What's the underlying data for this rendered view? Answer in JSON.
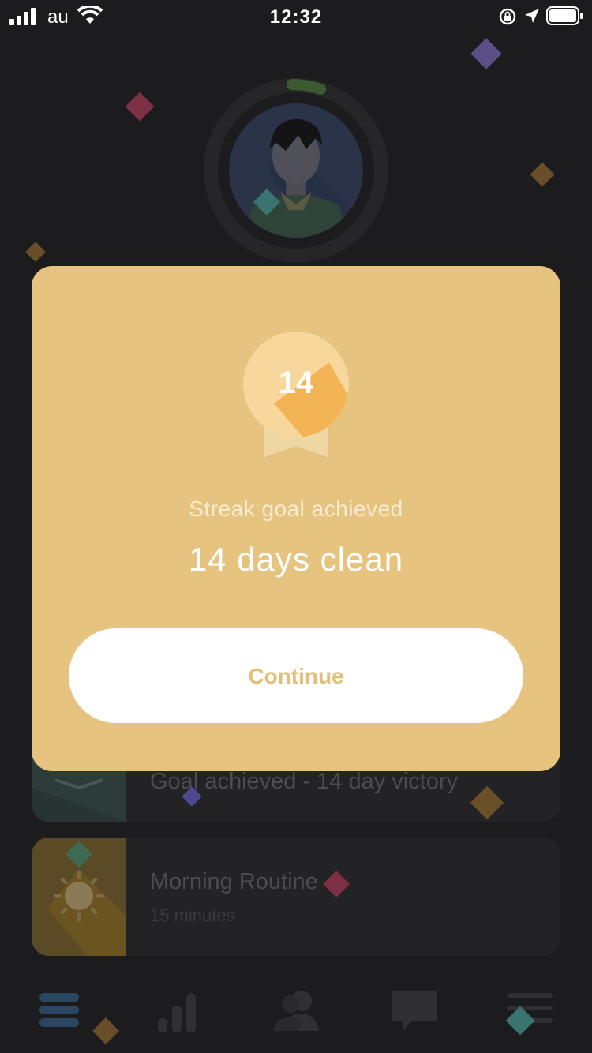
{
  "status_bar": {
    "carrier": "au",
    "time": "12:32"
  },
  "background": {
    "cards": [
      {
        "title": "Goal achieved - 14 day victory",
        "icon": "envelope-icon",
        "thumb_color": "#2e3b3b"
      },
      {
        "title": "Morning Routine",
        "subtitle": "15 minutes",
        "icon": "sun-icon",
        "thumb_color": "#5a4a25"
      }
    ],
    "tabs": [
      {
        "icon": "list-icon",
        "active": true
      },
      {
        "icon": "bar-chart-icon"
      },
      {
        "icon": "community-icon"
      },
      {
        "icon": "chat-icon"
      },
      {
        "icon": "menu-icon"
      }
    ]
  },
  "modal": {
    "badge_number": "14",
    "subtitle": "Streak goal achieved",
    "title": "14 days clean",
    "continue_label": "Continue"
  },
  "colors": {
    "modal_background": "#e6c480",
    "badge_light": "#f7d79b",
    "badge_accent": "#f2b454",
    "button_text": "#e3c07a",
    "app_background": "#1c1c1e"
  }
}
